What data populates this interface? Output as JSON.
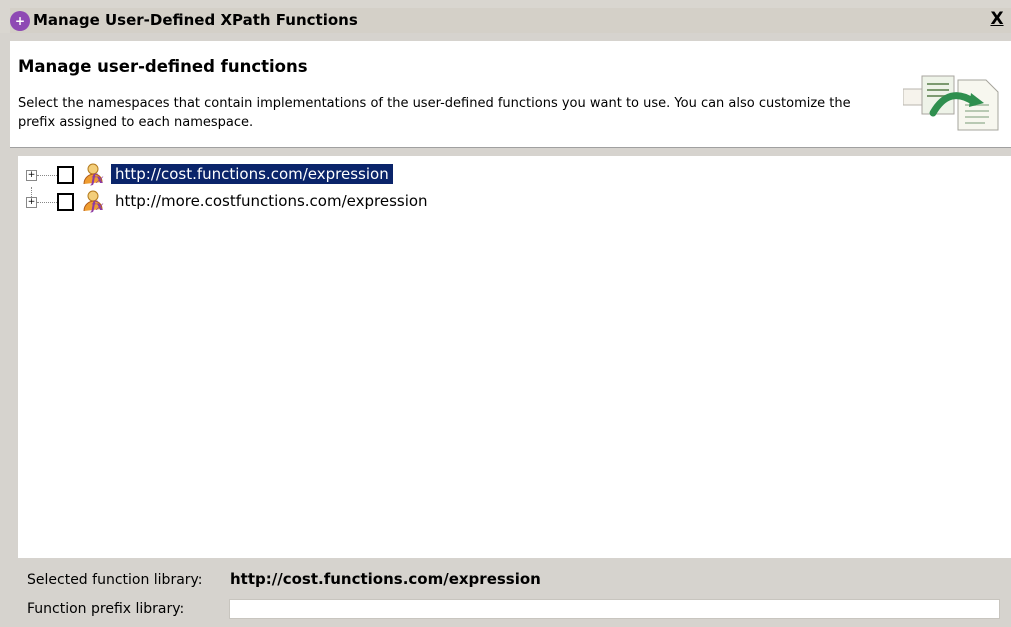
{
  "window": {
    "title": "Manage User-Defined XPath Functions",
    "close_label": "X"
  },
  "header": {
    "title": "Manage user-defined functions",
    "description": "Select the namespaces that contain implementations of the user-defined functions you want to use. You can also customize the prefix assigned to each namespace."
  },
  "namespaces": [
    {
      "label": "http://cost.functions.com/expression",
      "selected": true,
      "checked": false,
      "expanded": false
    },
    {
      "label": "http://more.costfunctions.com/expression",
      "selected": false,
      "checked": false,
      "expanded": false
    }
  ],
  "footer": {
    "selected_library_label": "Selected function library:",
    "selected_library_value": "http://cost.functions.com/expression",
    "prefix_label": "Function prefix library:",
    "prefix_value": ""
  },
  "colors": {
    "selection_bg": "#0a246a",
    "title_icon": "#8e49b4"
  },
  "icons": {
    "title": "xpath-function-icon",
    "namespace": "function-namespace-icon",
    "header": "wizard-functions-icon"
  }
}
